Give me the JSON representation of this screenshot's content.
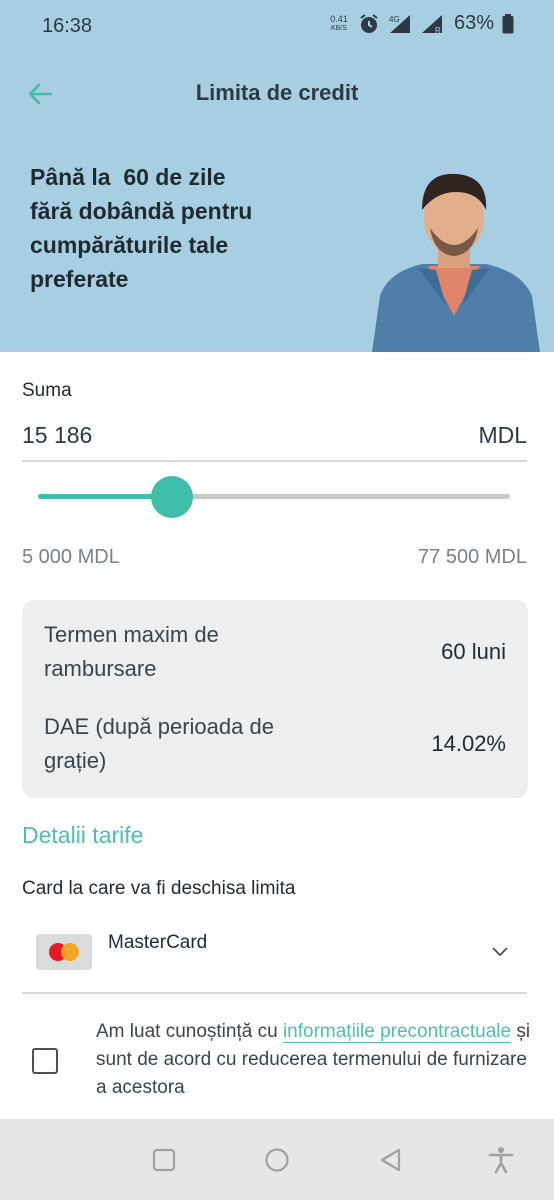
{
  "status_bar": {
    "time": "16:38",
    "net_speed_value": "0.41",
    "net_speed_unit": "KB/S",
    "network_type": "4G",
    "roaming_letter": "R",
    "battery_percent": "63%"
  },
  "header": {
    "title": "Limita de credit",
    "back_icon": "arrow-left-icon"
  },
  "promo": {
    "line1": "Până la  60 de zile",
    "line2": "fără dobândă pentru",
    "line3": "cumpărăturile tale",
    "line4": "preferate"
  },
  "amount": {
    "label": "Suma",
    "value": "15 186",
    "currency": "MDL",
    "min_label": "5 000 MDL",
    "max_label": "77 500 MDL",
    "slider_min": 5000,
    "slider_max": 77500,
    "slider_value": 15186
  },
  "info": {
    "term_label": "Termen maxim de rambursare",
    "term_value": "60 luni",
    "dae_label": "DAE (după perioada de grație)",
    "dae_value": "14.02%"
  },
  "tariffs_link": "Detalii tarife",
  "card": {
    "label": "Card la care va fi deschisa limita",
    "selected": "MasterCard"
  },
  "consent": {
    "text_before": "Am luat cunoștință cu ",
    "link": "informațiile precontractuale",
    "text_after": " și sunt de acord cu reducerea termenului de furnizare a acestora",
    "checked": false
  },
  "colors": {
    "accent": "#3fbfa9",
    "hero_bg": "#a7cfe1",
    "link": "#4cbfae"
  }
}
